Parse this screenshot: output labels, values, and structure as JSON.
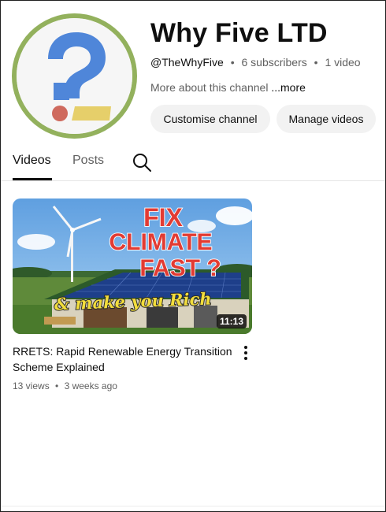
{
  "channel": {
    "name": "Why Five LTD",
    "handle": "@TheWhyFive",
    "separator": "•",
    "subscribers": "6 subscribers",
    "video_count": "1 video",
    "about": "More about this channel",
    "more": "...more",
    "avatar_icon": "question-mark-logo-icon"
  },
  "buttons": {
    "customise": "Customise channel",
    "manage": "Manage videos"
  },
  "tabs": [
    {
      "label": "Videos",
      "selected": true
    },
    {
      "label": "Posts",
      "selected": false
    }
  ],
  "search_icon": "search-icon",
  "video": {
    "thumbnail_text": [
      "FIX",
      "CLIMATE",
      "FAST ?",
      "& make you Rich"
    ],
    "duration": "11:13",
    "title": "RRETS: Rapid Renewable Energy Transition Scheme Explained",
    "views": "13 views",
    "separator": "•",
    "age": "3 weeks ago"
  },
  "colors": {
    "avatar_ring": "#93b15d",
    "question_mark": "#4f86d9",
    "dot": "#cf6a5e",
    "bar": "#e6cf6a"
  }
}
